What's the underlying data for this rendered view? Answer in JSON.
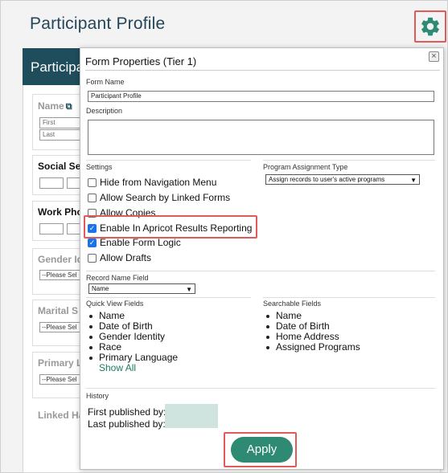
{
  "page": {
    "title": "Participant Profile",
    "header_partial": "Participa",
    "name_label": "Name",
    "first_placeholder": "First",
    "last_placeholder": "Last",
    "social_label": "Social Se",
    "work_phone_label": "Work Pho",
    "gender_label": "Gender Id",
    "marital_label": "Marital S",
    "primary_label": "Primary L",
    "linked_label": "Linked Ha",
    "please_select": "--Please Sel"
  },
  "modal": {
    "title": "Form Properties (Tier 1)",
    "close_glyph": "×",
    "form_name_label": "Form Name",
    "form_name_value": "Participant Profile",
    "description_label": "Description",
    "settings_label": "Settings",
    "settings": [
      {
        "label": "Hide from Navigation Menu",
        "checked": false
      },
      {
        "label": "Allow Search by Linked Forms",
        "checked": false
      },
      {
        "label": "Allow Copies",
        "checked": false
      },
      {
        "label": "Enable In Apricot Results Reporting",
        "checked": true
      },
      {
        "label": "Enable Form Logic",
        "checked": true
      },
      {
        "label": "Allow Drafts",
        "checked": false
      }
    ],
    "program_assignment_label": "Program Assignment Type",
    "program_assignment_value": "Assign records to user's active programs",
    "record_name_label": "Record Name Field",
    "record_name_value": "Name",
    "quick_view_label": "Quick View Fields",
    "quick_view_items": [
      "Name",
      "Date of Birth",
      "Gender Identity",
      "Race",
      "Primary Language"
    ],
    "show_all": "Show All",
    "searchable_label": "Searchable Fields",
    "searchable_items": [
      "Name",
      "Date of Birth",
      "Home Address",
      "Assigned Programs"
    ],
    "history_label": "History",
    "first_published": "First published by:",
    "last_published": "Last published by:",
    "apply_label": "Apply"
  },
  "colors": {
    "accent": "#2e8a72",
    "highlight": "#e05a5a",
    "header_bg": "#1f4d5c"
  }
}
